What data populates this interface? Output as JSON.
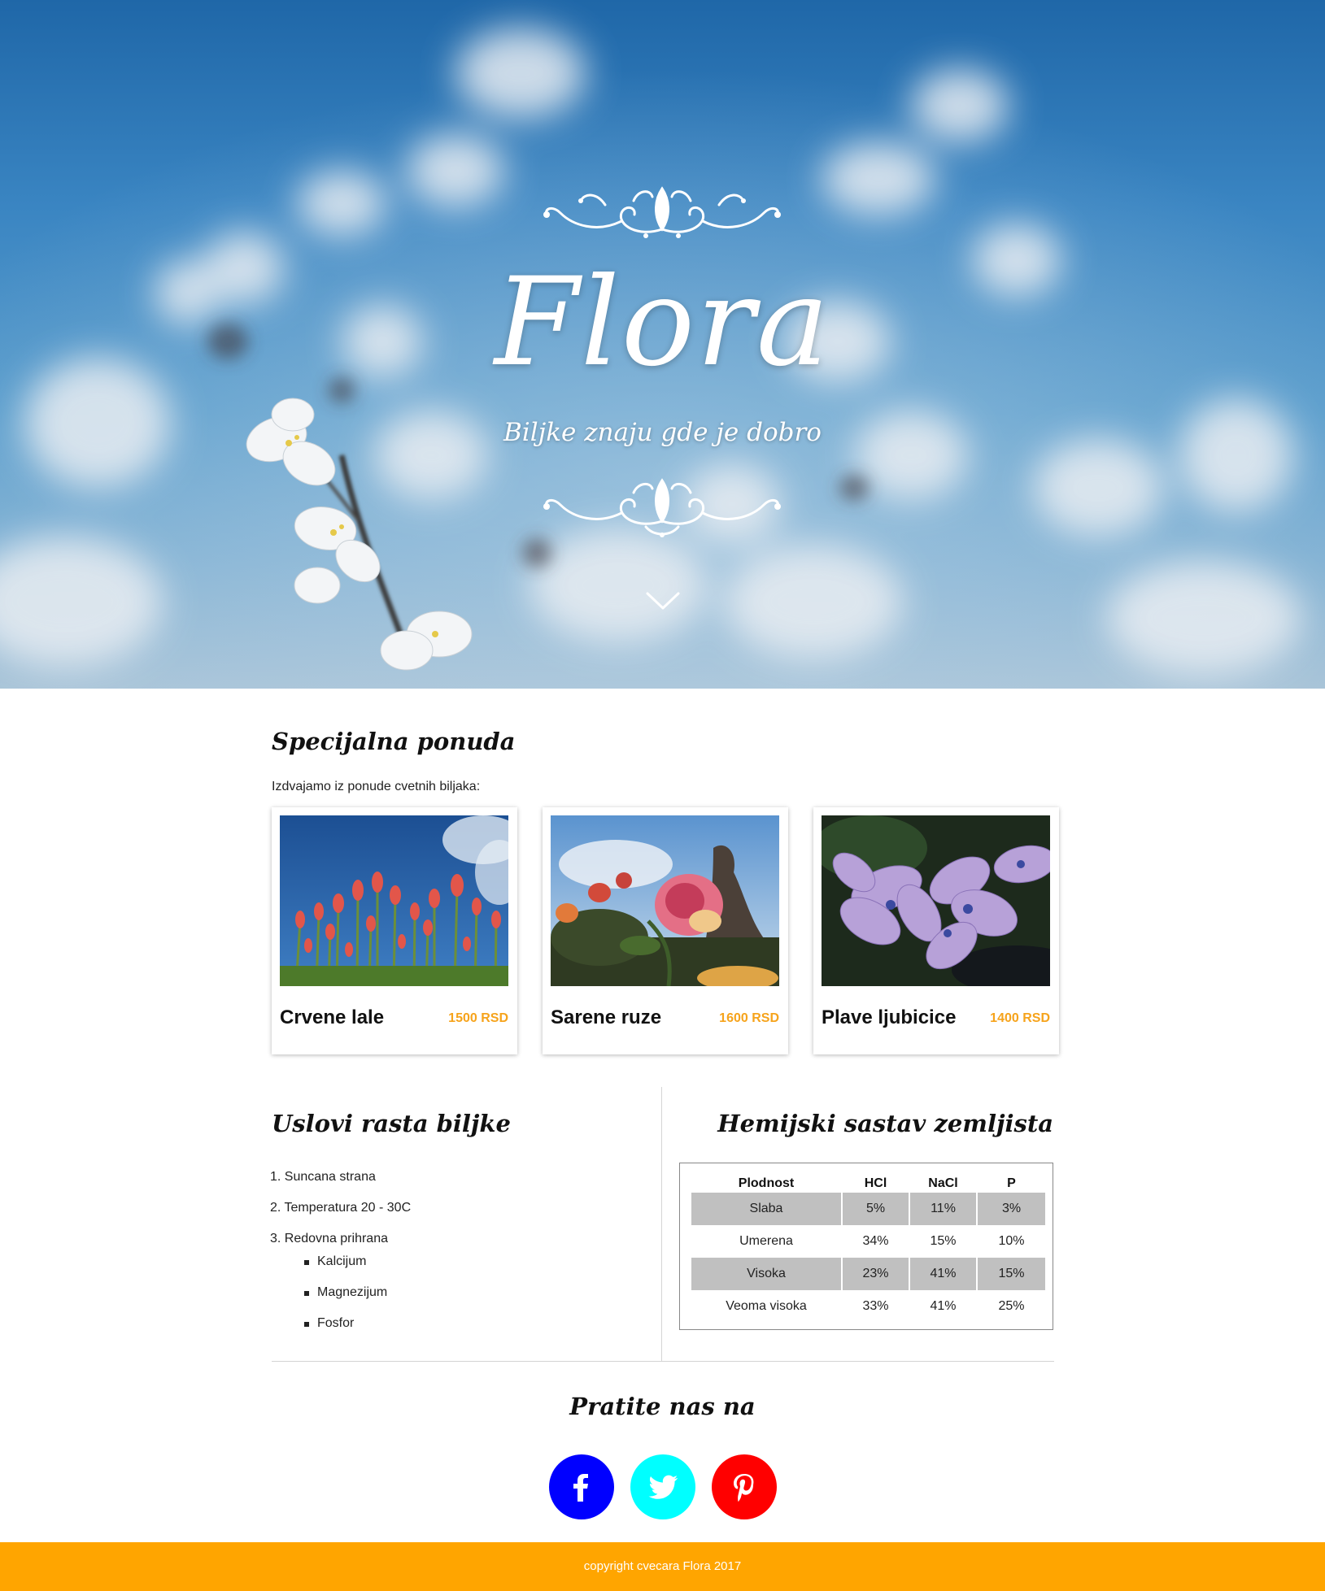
{
  "hero": {
    "brand": "Flora",
    "tagline": "Biljke znaju gde je dobro",
    "scroll_icon": "chevron-down-icon"
  },
  "offer": {
    "title": "Specijalna ponuda",
    "intro": "Izdvajamo iz ponude cvetnih biljaka:",
    "cards": [
      {
        "name": "Crvene lale",
        "price": "1500 RSD",
        "image": "red-tulips-photo"
      },
      {
        "name": "Sarene ruze",
        "price": "1600 RSD",
        "image": "colorful-roses-photo"
      },
      {
        "name": "Plave ljubicice",
        "price": "1400 RSD",
        "image": "blue-violets-photo"
      }
    ]
  },
  "conditions": {
    "title": "Uslovi rasta biljke",
    "items": [
      {
        "label": "1. Suncana strana"
      },
      {
        "label": "2. Temperatura 20 - 30C"
      },
      {
        "label": "3. Redovna prihrana"
      }
    ],
    "sub_items": [
      {
        "label": "Kalcijum"
      },
      {
        "label": "Magnezijum"
      },
      {
        "label": "Fosfor"
      }
    ]
  },
  "soil": {
    "title": "Hemijski sastav zemljista",
    "headers": [
      "Plodnost",
      "HCl",
      "NaCl",
      "P"
    ],
    "rows": [
      [
        "Slaba",
        "5%",
        "11%",
        "3%"
      ],
      [
        "Umerena",
        "34%",
        "15%",
        "10%"
      ],
      [
        "Visoka",
        "23%",
        "41%",
        "15%"
      ],
      [
        "Veoma visoka",
        "33%",
        "41%",
        "25%"
      ]
    ]
  },
  "social": {
    "title": "Pratite nas na",
    "links": [
      {
        "name": "facebook",
        "icon": "facebook-icon",
        "color": "#0000ff"
      },
      {
        "name": "twitter",
        "icon": "twitter-icon",
        "color": "#00ffff"
      },
      {
        "name": "pinterest",
        "icon": "pinterest-icon",
        "color": "#ff0000"
      }
    ]
  },
  "footer": {
    "copyright": "copyright cvecara Flora 2017",
    "color": "#ffa500"
  },
  "colors": {
    "price": "#f6a31b",
    "table_shade": "#c0c0c0"
  }
}
